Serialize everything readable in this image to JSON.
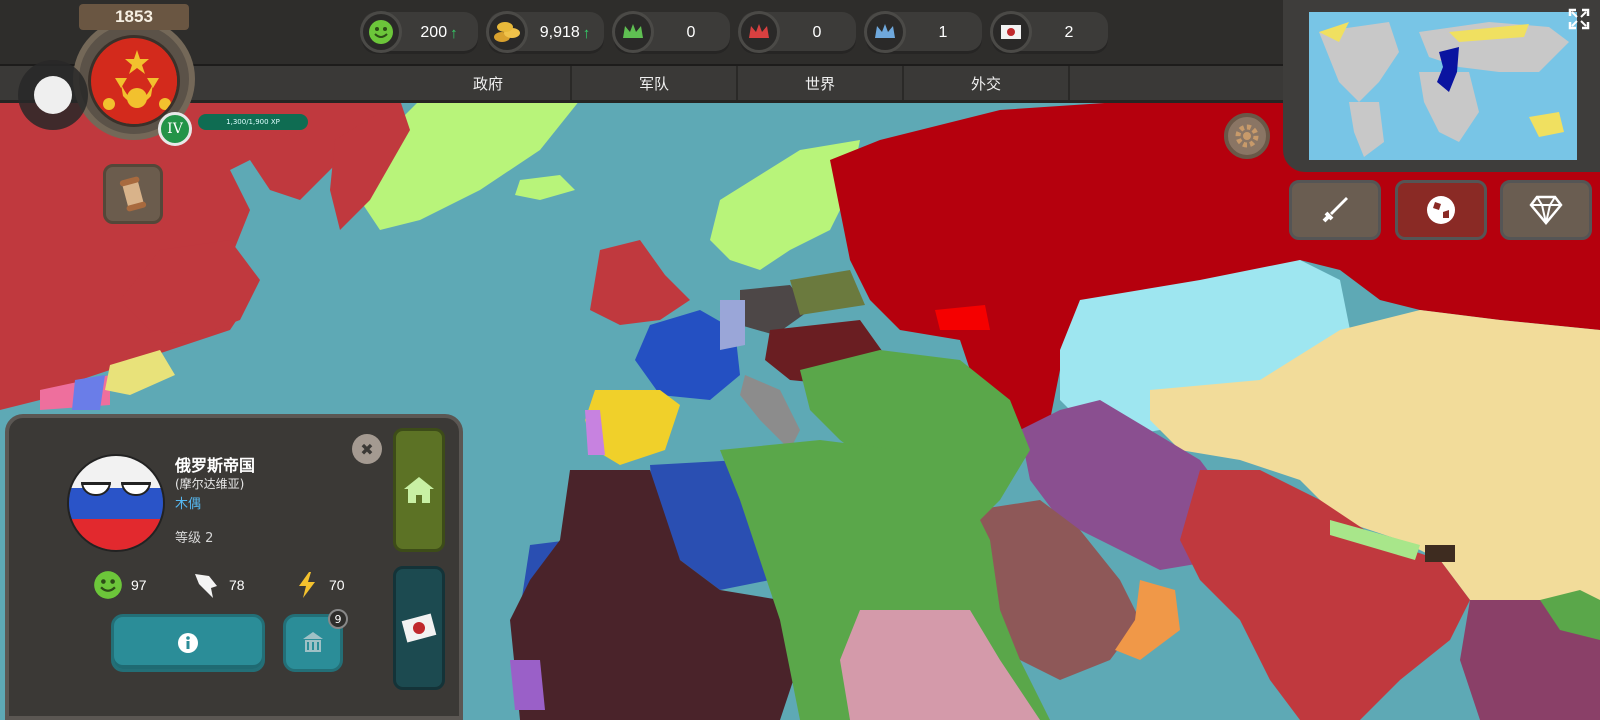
{
  "year": "1853",
  "player": {
    "rank": "IV",
    "xp": "1,300/1,900 XP"
  },
  "resources": [
    {
      "name": "happiness",
      "icon": "smiley-icon",
      "value": "200",
      "trend": "up",
      "color": "#6cc63a"
    },
    {
      "name": "gold",
      "icon": "coins-icon",
      "value": "9,918",
      "trend": "up",
      "color": "#e8b93a"
    },
    {
      "name": "green-crown",
      "icon": "green-crown-icon",
      "value": "0",
      "color": "#5fbf52"
    },
    {
      "name": "red-crown",
      "icon": "red-crown-icon",
      "value": "0",
      "color": "#d84040"
    },
    {
      "name": "blue-crown",
      "icon": "blue-crown-icon",
      "value": "1",
      "color": "#6fa8dc"
    },
    {
      "name": "letters",
      "icon": "letter-icon",
      "value": "2",
      "color": "#f2f2f2"
    }
  ],
  "tabs": [
    "政府",
    "军队",
    "世界",
    "外交"
  ],
  "quick_buttons": [
    {
      "name": "sword-button",
      "icon": "sword-icon",
      "color": "#6a5d51"
    },
    {
      "name": "world-button",
      "icon": "globe-icon",
      "color": "#8a2a25"
    },
    {
      "name": "diamond-button",
      "icon": "diamond-icon",
      "color": "#6a5d51"
    }
  ],
  "country_panel": {
    "name": "俄罗斯帝国",
    "subtitle": "(摩尔达维亚)",
    "status": "木偶",
    "level": "等级 2",
    "happiness": "97",
    "army": "78",
    "power": "70",
    "building_badge": "9"
  },
  "colors": {
    "ocean": "#5ea9b5",
    "russia": "#b5000d",
    "ui_dark": "#2e2d2b",
    "teal_button": "#2b8d98"
  }
}
